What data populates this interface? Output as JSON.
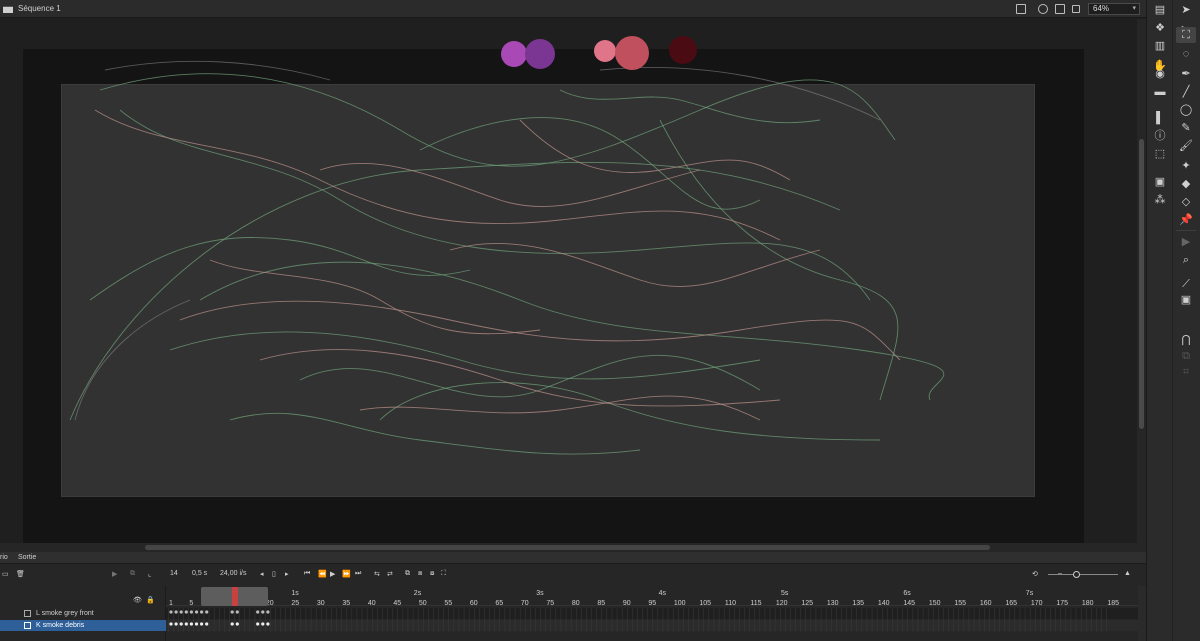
{
  "window": {
    "title": "Séquence 1",
    "zoom": "64%"
  },
  "colors": {
    "swatch1": "#a849b6",
    "swatch2": "#7b3592",
    "swatch3": "#e07488",
    "swatch4": "#c0505e",
    "swatch5": "#4a0b12"
  },
  "timeline": {
    "tabs": [
      "rio",
      "Sortie"
    ],
    "current_frame": "14",
    "time": "0,5 s",
    "fps": "24,00 i/s",
    "seconds": [
      "1s",
      "2s",
      "3s",
      "4s",
      "5s",
      "6s",
      "7s"
    ],
    "frames": [
      "1",
      "5",
      "10",
      "15",
      "20",
      "25",
      "30",
      "35",
      "40",
      "45",
      "50",
      "55",
      "60",
      "65",
      "70",
      "75",
      "80",
      "85",
      "90",
      "95",
      "100",
      "105",
      "110",
      "115",
      "120",
      "125",
      "130",
      "135",
      "140",
      "145",
      "150",
      "155",
      "160",
      "165",
      "170",
      "175",
      "180",
      "185"
    ],
    "layers": [
      {
        "name": "L smoke grey front",
        "selected": false
      },
      {
        "name": "K smoke debris",
        "selected": true
      }
    ]
  },
  "tools": [
    "properties-icon",
    "assets-icon",
    "library-icon",
    "hand-icon",
    "selection-icon",
    "subselection-icon",
    "free-transform-icon",
    "lasso-icon",
    "3d-icon",
    "stroke-icon",
    "pen-icon",
    "line-icon",
    "oval-icon",
    "align-icon",
    "info-icon",
    "transform-panel-icon",
    "pencil-icon",
    "brush-icon",
    "bone-icon",
    "paint-bucket-icon",
    "eraser-icon",
    "pin-icon",
    "camera-icon",
    "zoom-icon",
    "eyedropper-icon",
    "stroke-fill-icon",
    "snap-icon",
    "swap-icon",
    "wrap-icon"
  ]
}
